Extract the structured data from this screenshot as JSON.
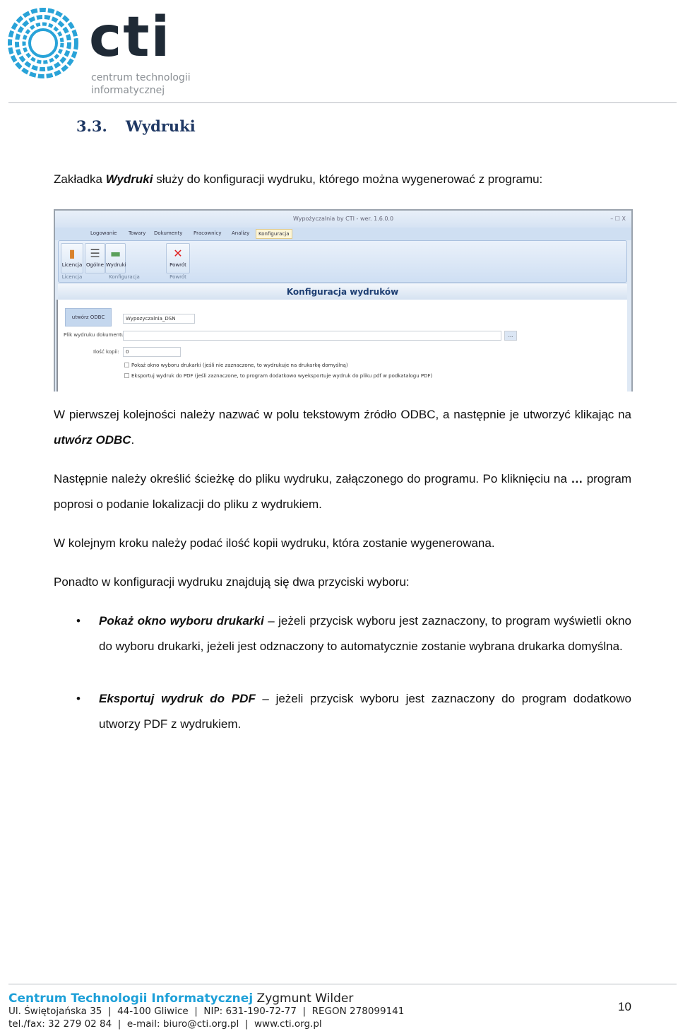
{
  "header": {
    "logo_text": "cti",
    "logo_sub1": "centrum technologii",
    "logo_sub2": "informatycznej",
    "brand_color": "#29a3d8"
  },
  "section": {
    "number": "3.3.",
    "title": "Wydruki"
  },
  "intro": {
    "pre": "Zakładka ",
    "bold": "Wydruki",
    "post": " służy do konfiguracji wydruku, którego można wygenerować z programu:"
  },
  "app": {
    "title": "Wypożyczalnia by CTI -    wer. 1.6.0.0",
    "window_controls": "–  ☐  X",
    "tabs": [
      "Logowanie",
      "Towary",
      "Dokumenty",
      "Pracownicy",
      "Analizy",
      "Konfiguracja"
    ],
    "buttons": [
      "Licencja",
      "Ogólne",
      "Wydruki",
      "Powrót"
    ],
    "groups": [
      "Licencja",
      "Konfiguracja",
      "Powrót"
    ],
    "header": "Konfiguracja wydruków",
    "odbc_button": "utwórz ODBC",
    "odbc_value": "Wypozyczalnia_DSN",
    "file_label": "Plik wydruku dokumentu",
    "file_value": "",
    "browse": "...",
    "copies_label": "Ilość kopii:",
    "copies_value": "0",
    "check1": "Pokaż okno wyboru drukarki (jeśli nie zaznaczone, to wydrukuje na drukarkę domyślną)",
    "check2": "Eksportuj wydruk do PDF (jeśli zaznaczone, to program dodatkowo wyeksportuje wydruk do pliku pdf w podkatalogu PDF)"
  },
  "paragraphs": {
    "p1_pre": "W pierwszej kolejności należy nazwać w polu tekstowym źródło ODBC, a następnie je utworzyć klikając na ",
    "p1_bold": "utwórz ODBC",
    "p1_post": ".",
    "p2_pre": "Następnie należy określić ścieżkę do pliku wydruku, załączonego do programu. Po kliknięciu na ",
    "p2_bold": "…",
    "p2_post": " program poprosi o podanie lokalizacji do pliku z wydrukiem.",
    "p3": "W kolejnym kroku należy podać ilość kopii wydruku, która zostanie wygenerowana.",
    "p4": "Ponadto w konfiguracji wydruku znajdują się dwa przyciski wyboru:"
  },
  "bullets": [
    {
      "bold": "Pokaż okno wyboru drukarki",
      "text": " – jeżeli przycisk wyboru jest zaznaczony, to program wyświetli okno do wyboru drukarki, jeżeli jest odznaczony to automatycznie zostanie wybrana drukarka domyślna."
    },
    {
      "bold": "Eksportuj wydruk do PDF",
      "text": " – jeżeli przycisk wyboru jest zaznaczony do program dodatkowo utworzy PDF z wydrukiem."
    }
  ],
  "footer": {
    "company": "Centrum Technologii Informatycznej",
    "owner": " Zygmunt Wilder",
    "line1": "Ul. Świętojańska 35  |  44-100 Gliwice  |  NIP: 631-190-72-77  |  REGON 278099141",
    "line2": "tel./fax: 32 279 02 84  |  e-mail: biuro@cti.org.pl  |  www.cti.org.pl",
    "page": "10"
  }
}
